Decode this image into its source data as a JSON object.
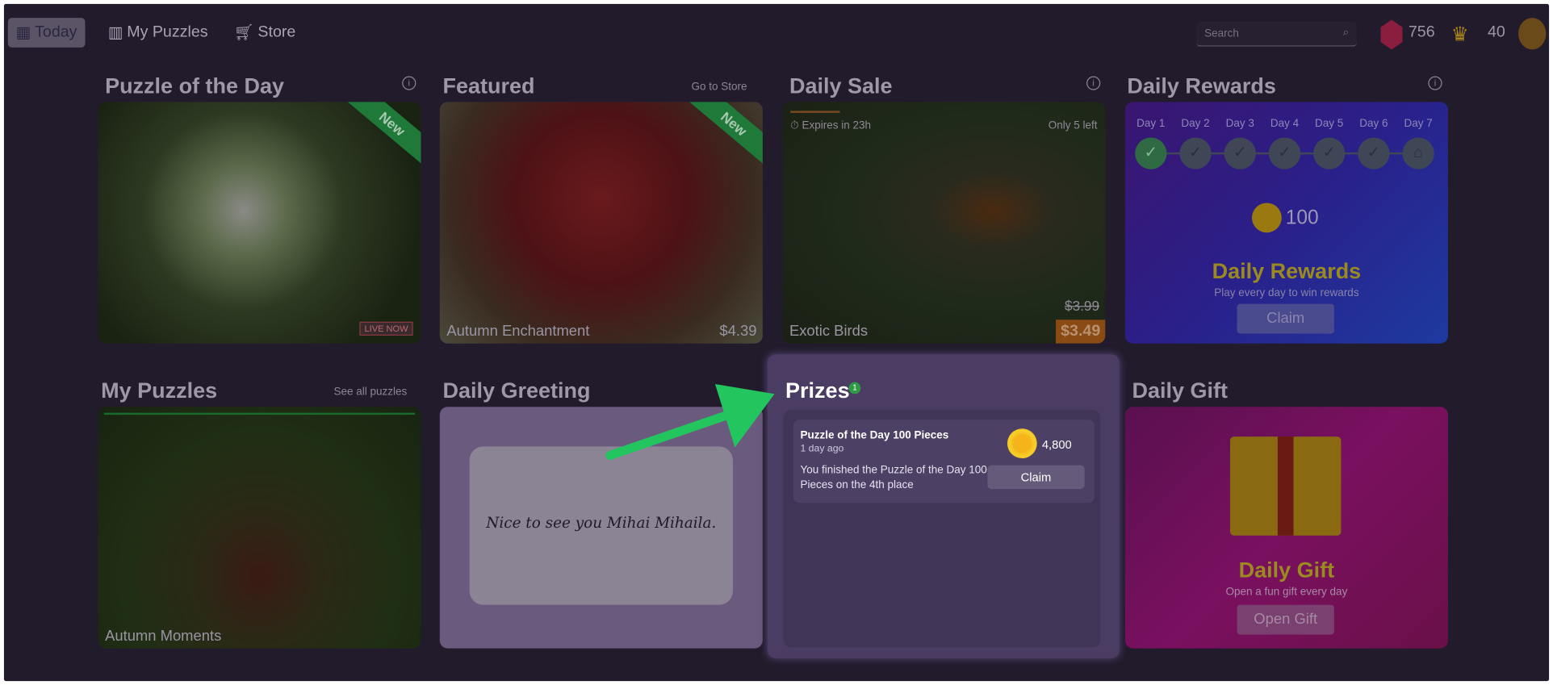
{
  "nav": {
    "items": [
      {
        "label": "Today",
        "icon": "calendar-icon",
        "active": true
      },
      {
        "label": "My Puzzles",
        "icon": "library-icon"
      },
      {
        "label": "Store",
        "icon": "cart-icon"
      }
    ]
  },
  "search": {
    "placeholder": "Search"
  },
  "currency": {
    "gems": "756",
    "crowns": "40"
  },
  "puzzle_of_day": {
    "title": "Puzzle of the Day",
    "ribbon": "New",
    "badge": "LIVE NOW"
  },
  "featured": {
    "title": "Featured",
    "link": "Go to Store",
    "ribbon": "New",
    "caption": "Autumn Enchantment",
    "price": "$4.39"
  },
  "daily_sale": {
    "title": "Daily Sale",
    "expires": "Expires in 23h",
    "stock": "Only 5 left",
    "caption": "Exotic Birds",
    "old_price": "$3.99",
    "price": "$3.49"
  },
  "daily_rewards": {
    "title": "Daily Rewards",
    "days": [
      "Day 1",
      "Day 2",
      "Day 3",
      "Day 4",
      "Day 5",
      "Day 6",
      "Day 7"
    ],
    "amount": "100",
    "heading": "Daily Rewards",
    "subtitle": "Play every day to win rewards",
    "button": "Claim"
  },
  "my_puzzles": {
    "title": "My Puzzles",
    "link": "See all puzzles",
    "caption": "Autumn Moments"
  },
  "daily_greeting": {
    "title": "Daily Greeting",
    "message": "Nice to see you Mihai Mihaila."
  },
  "prizes": {
    "title": "Prizes",
    "count": "1",
    "item": {
      "name": "Puzzle of the Day 100 Pieces",
      "time": "1 day ago",
      "description": "You finished the Puzzle of the Day 100 Pieces on the 4th place",
      "amount": "4,800",
      "button": "Claim"
    }
  },
  "daily_gift": {
    "title": "Daily Gift",
    "heading": "Daily Gift",
    "subtitle": "Open a fun gift every day",
    "button": "Open Gift"
  },
  "colors": {
    "accent_arrow": "#22c55e",
    "background": "#221b2c",
    "prizes_panel": "#4a3c62"
  }
}
